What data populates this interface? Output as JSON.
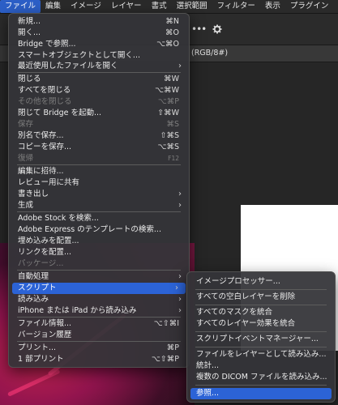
{
  "menubar": [
    "ファイル",
    "編集",
    "イメージ",
    "レイヤー",
    "書式",
    "選択範囲",
    "フィルター",
    "表示",
    "プラグイン"
  ],
  "options": {
    "more": "•••"
  },
  "doc_tab": "(RGB/8#)",
  "file_menu": [
    {
      "label": "新規...",
      "shortcut": "⌘N"
    },
    {
      "label": "開く...",
      "shortcut": "⌘O"
    },
    {
      "label": "Bridge で参照...",
      "shortcut": "⌥⌘O"
    },
    {
      "label": "スマートオブジェクトとして開く...",
      "shortcut": ""
    },
    {
      "label": "最近使用したファイルを開く",
      "shortcut": "",
      "submenu": true
    },
    {
      "label": "閉じる",
      "shortcut": "⌘W"
    },
    {
      "label": "すべてを閉じる",
      "shortcut": "⌥⌘W"
    },
    {
      "label": "その他を閉じる",
      "shortcut": "⌥⌘P",
      "disabled": true
    },
    {
      "label": "閉じて Bridge を起動...",
      "shortcut": "⇧⌘W"
    },
    {
      "label": "保存",
      "shortcut": "⌘S",
      "disabled": true
    },
    {
      "label": "別名で保存...",
      "shortcut": "⇧⌘S"
    },
    {
      "label": "コピーを保存...",
      "shortcut": "⌥⌘S"
    },
    {
      "label": "復帰",
      "shortcut": "F12",
      "disabled": true
    },
    {
      "label": "編集に招待...",
      "shortcut": ""
    },
    {
      "label": "レビュー用に共有",
      "shortcut": ""
    },
    {
      "label": "書き出し",
      "shortcut": "",
      "submenu": true
    },
    {
      "label": "生成",
      "shortcut": "",
      "submenu": true
    },
    {
      "label": "Adobe Stock を検索...",
      "shortcut": ""
    },
    {
      "label": "Adobe Express のテンプレートの検索...",
      "shortcut": ""
    },
    {
      "label": "埋め込みを配置...",
      "shortcut": ""
    },
    {
      "label": "リンクを配置...",
      "shortcut": ""
    },
    {
      "label": "パッケージ...",
      "shortcut": "",
      "disabled": true
    },
    {
      "label": "自動処理",
      "shortcut": "",
      "submenu": true
    },
    {
      "label": "スクリプト",
      "shortcut": "",
      "submenu": true,
      "highlighted": true
    },
    {
      "label": "読み込み",
      "shortcut": "",
      "submenu": true
    },
    {
      "label": "iPhone または iPad から読み込み",
      "shortcut": "",
      "submenu": true
    },
    {
      "label": "ファイル情報...",
      "shortcut": "⌥⇧⌘I"
    },
    {
      "label": "バージョン履歴",
      "shortcut": ""
    },
    {
      "label": "プリント...",
      "shortcut": "⌘P"
    },
    {
      "label": "1 部プリント",
      "shortcut": "⌥⇧⌘P"
    }
  ],
  "script_submenu": [
    {
      "label": "イメージプロセッサー..."
    },
    {
      "label": "すべての空白レイヤーを削除"
    },
    {
      "label": "すべてのマスクを統合"
    },
    {
      "label": "すべてのレイヤー効果を統合"
    },
    {
      "label": "スクリプトイベントマネージャー..."
    },
    {
      "label": "ファイルをレイヤーとして読み込み..."
    },
    {
      "label": "統計..."
    },
    {
      "label": "複数の DICOM ファイルを読み込み..."
    },
    {
      "label": "参照...",
      "highlighted": true
    }
  ],
  "colors": {
    "accent": "#2c63d6",
    "menu_bg": "#343438",
    "disabled": "#7d7d7d"
  }
}
